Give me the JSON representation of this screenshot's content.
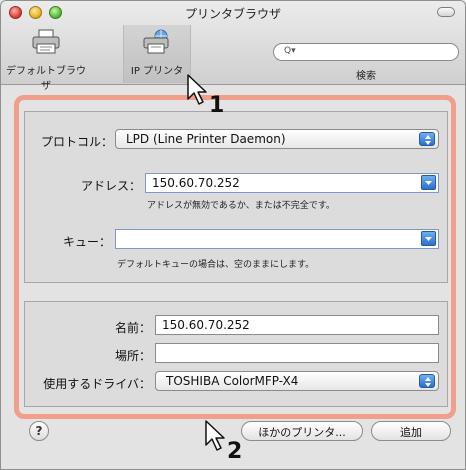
{
  "window": {
    "title": "プリンタブラウザ"
  },
  "toolbar": {
    "default_browser_label": "デフォルトブラウザ",
    "ip_printer_label": "IP プリンタ",
    "search_placeholder": "Q▾",
    "search_label": "検索"
  },
  "ip_panel": {
    "protocol_label": "プロトコル：",
    "protocol_value": "LPD (Line Printer Daemon)",
    "address_label": "アドレス：",
    "address_value": "150.60.70.252",
    "address_hint": "アドレスが無効であるか、または不完全です。",
    "queue_label": "キュー：",
    "queue_value": "",
    "queue_hint": "デフォルトキューの場合は、空のままにします。"
  },
  "printer_info": {
    "name_label": "名前：",
    "name_value": "150.60.70.252",
    "location_label": "場所：",
    "location_value": "",
    "driver_label": "使用するドライバ：",
    "driver_value": "TOSHIBA ColorMFP-X4"
  },
  "footer": {
    "help_label": "?",
    "more_printers_label": "ほかのプリンタ...",
    "add_label": "追加"
  },
  "callouts": {
    "one": "1",
    "two": "2"
  }
}
